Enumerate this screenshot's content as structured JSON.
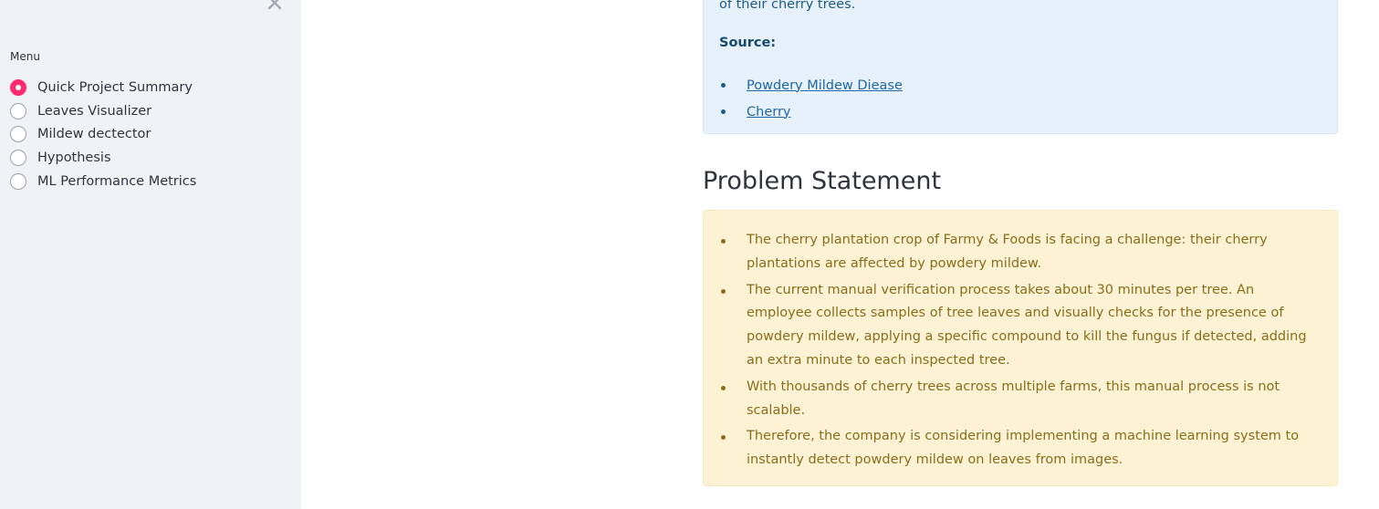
{
  "sidebar": {
    "menu_label": "Menu",
    "items": [
      {
        "label": "Quick Project Summary",
        "checked": true
      },
      {
        "label": "Leaves Visualizer",
        "checked": false
      },
      {
        "label": "Mildew dectector",
        "checked": false
      },
      {
        "label": "Hypothesis",
        "checked": false
      },
      {
        "label": "ML Performance Metrics",
        "checked": false
      }
    ]
  },
  "info": {
    "text": "of their cherry trees.",
    "source_label": "Source:",
    "links": [
      "Powdery Mildew Diease",
      "Cherry"
    ]
  },
  "problem": {
    "heading": "Problem Statement",
    "bullets": [
      "The cherry plantation crop of Farmy & Foods is facing a challenge: their cherry plantations are affected by powdery mildew.",
      "The current manual verification process takes about 30 minutes per tree. An employee collects samples of tree leaves and visually checks for the presence of powdery mildew, applying a specific compound to kill the fungus if detected, adding an extra minute to each inspected tree.",
      "With thousands of cherry trees across multiple farms, this manual process is not scalable.",
      "Therefore, the company is considering implementing a machine learning system to instantly detect powdery mildew on leaves from images."
    ]
  },
  "colors": {
    "accent": "#ff2b6e",
    "sidebar_bg": "#f0f2f6",
    "info_bg": "#e7f1fb",
    "warning_bg": "#fdf2d4",
    "warning_text": "#8a6d1a"
  }
}
